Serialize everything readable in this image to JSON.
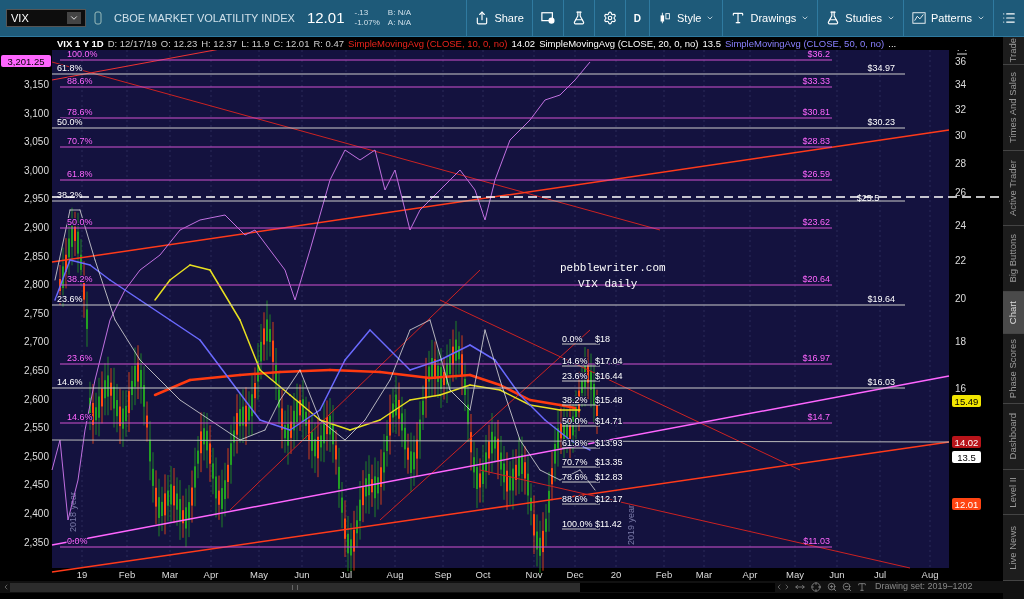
{
  "toolbar": {
    "symbol": "VIX",
    "description": "CBOE MARKET VOLATILITY INDEX",
    "last": "12.01",
    "change": "-.13",
    "change_pct": "-1.07%",
    "bid": "B: N/A",
    "ask": "A: N/A",
    "buttons": [
      {
        "kind": "share",
        "label": "Share"
      },
      {
        "kind": "alert"
      },
      {
        "kind": "flask"
      },
      {
        "kind": "gear"
      },
      {
        "kind": "text",
        "label": "D"
      },
      {
        "kind": "style",
        "label": "Style"
      },
      {
        "kind": "drawings",
        "label": "Drawings"
      },
      {
        "kind": "studies",
        "label": "Studies"
      },
      {
        "kind": "patterns",
        "label": "Patterns"
      },
      {
        "kind": "menu"
      }
    ]
  },
  "legend": {
    "header": "VIX 1 Y 1D",
    "fields": [
      "D: 12/17/19",
      "O: 12.23",
      "H: 12.37",
      "L: 11.9",
      "C: 12.01",
      "R: 0.47"
    ],
    "studies": [
      {
        "name": "SimpleMovingAvg (CLOSE, 10, 0, no)",
        "value": "14.02"
      },
      {
        "name": "SimpleMovingAvg (CLOSE, 20, 0, no)",
        "value": "13.5"
      },
      {
        "name": "SimpleMovingAvg (CLOSE, 50, 0, no)",
        "value": "..."
      }
    ]
  },
  "left_axis": {
    "badge": "3,201.25",
    "ticks": [
      "3,150",
      "3,100",
      "3,050",
      "3,000",
      "2,950",
      "2,900",
      "2,850",
      "2,800",
      "2,750",
      "2,700",
      "2,650",
      "2,600",
      "2,550",
      "2,500",
      "2,450",
      "2,400",
      "2,350"
    ]
  },
  "right_axis": {
    "ticks": [
      "36",
      "34",
      "32",
      "30",
      "28",
      "26",
      "24",
      "22",
      "20",
      "18",
      "16"
    ],
    "badges": [
      {
        "text": "15.49",
        "color": "#f2e600"
      },
      {
        "text": "14.02",
        "color": "#b8141a"
      },
      {
        "text": "13.5",
        "color": "#ffffff"
      },
      {
        "text": "12.01",
        "color": "#ff4412"
      }
    ]
  },
  "x_axis": [
    "19",
    "Feb",
    "Mar",
    "Apr",
    "May",
    "Jun",
    "Jul",
    "Aug",
    "Sep",
    "Oct",
    "Nov",
    "Dec",
    "20",
    "Feb",
    "Mar",
    "Apr",
    "May",
    "Jun",
    "Jul",
    "Aug"
  ],
  "year_markers": [
    "2018 year",
    "2019 year"
  ],
  "chart_annotation": [
    "pebblewriter.com",
    "VIX daily"
  ],
  "fib_magenta": [
    {
      "percent": "100.0%",
      "price": "$36.2"
    },
    {
      "percent": "88.6%",
      "price": "$33.33"
    },
    {
      "percent": "78.6%",
      "price": "$30.81"
    },
    {
      "percent": "70.7%",
      "price": "$28.83"
    },
    {
      "percent": "61.8%",
      "price": "$26.59"
    },
    {
      "percent": "50.0%",
      "price": "$23.62"
    },
    {
      "percent": "38.2%",
      "price": "$20.64"
    },
    {
      "percent": "23.6%",
      "price": "$16.97"
    },
    {
      "percent": "14.6%",
      "price": "$14.7"
    },
    {
      "percent": "0.0%",
      "price": "$11.03"
    }
  ],
  "fib_white": [
    {
      "percent": "61.8%",
      "price": "$34.97"
    },
    {
      "percent": "50.0%",
      "price": "$30.23"
    },
    {
      "percent": "38.2%"
    },
    {
      "percent": "23.6%",
      "price": "$19.64"
    },
    {
      "percent": "14.6%",
      "price": "$16.03"
    }
  ],
  "dashed_line": {
    "price": "$25.5"
  },
  "fib_small": [
    {
      "percent": "0.0%",
      "price": "$18"
    },
    {
      "percent": "14.6%",
      "price": "$17.04"
    },
    {
      "percent": "23.6%",
      "price": "$16.44"
    },
    {
      "percent": "38.2%",
      "price": "$15.48"
    },
    {
      "percent": "50.0%",
      "price": "$14.71"
    },
    {
      "percent": "61.8%",
      "price": "$13.93"
    },
    {
      "percent": "70.7%",
      "price": "$13.35"
    },
    {
      "percent": "78.6%",
      "price": "$12.83"
    },
    {
      "percent": "88.6%",
      "price": "$12.17"
    },
    {
      "percent": "100.0%",
      "price": "$11.42"
    }
  ],
  "drawing_set": "Drawing set: 2019–1202",
  "side_tabs": [
    {
      "label": "Trade",
      "selected": false
    },
    {
      "label": "Times And Sales",
      "selected": false
    },
    {
      "label": "Active Trader",
      "selected": false
    },
    {
      "label": "Big Buttons",
      "selected": false
    },
    {
      "label": "Chart",
      "selected": true
    },
    {
      "label": "Phase Scores",
      "selected": false
    },
    {
      "label": "Dashboard",
      "selected": false
    },
    {
      "label": "Level II",
      "selected": false
    },
    {
      "label": "Live News",
      "selected": false
    }
  ]
}
